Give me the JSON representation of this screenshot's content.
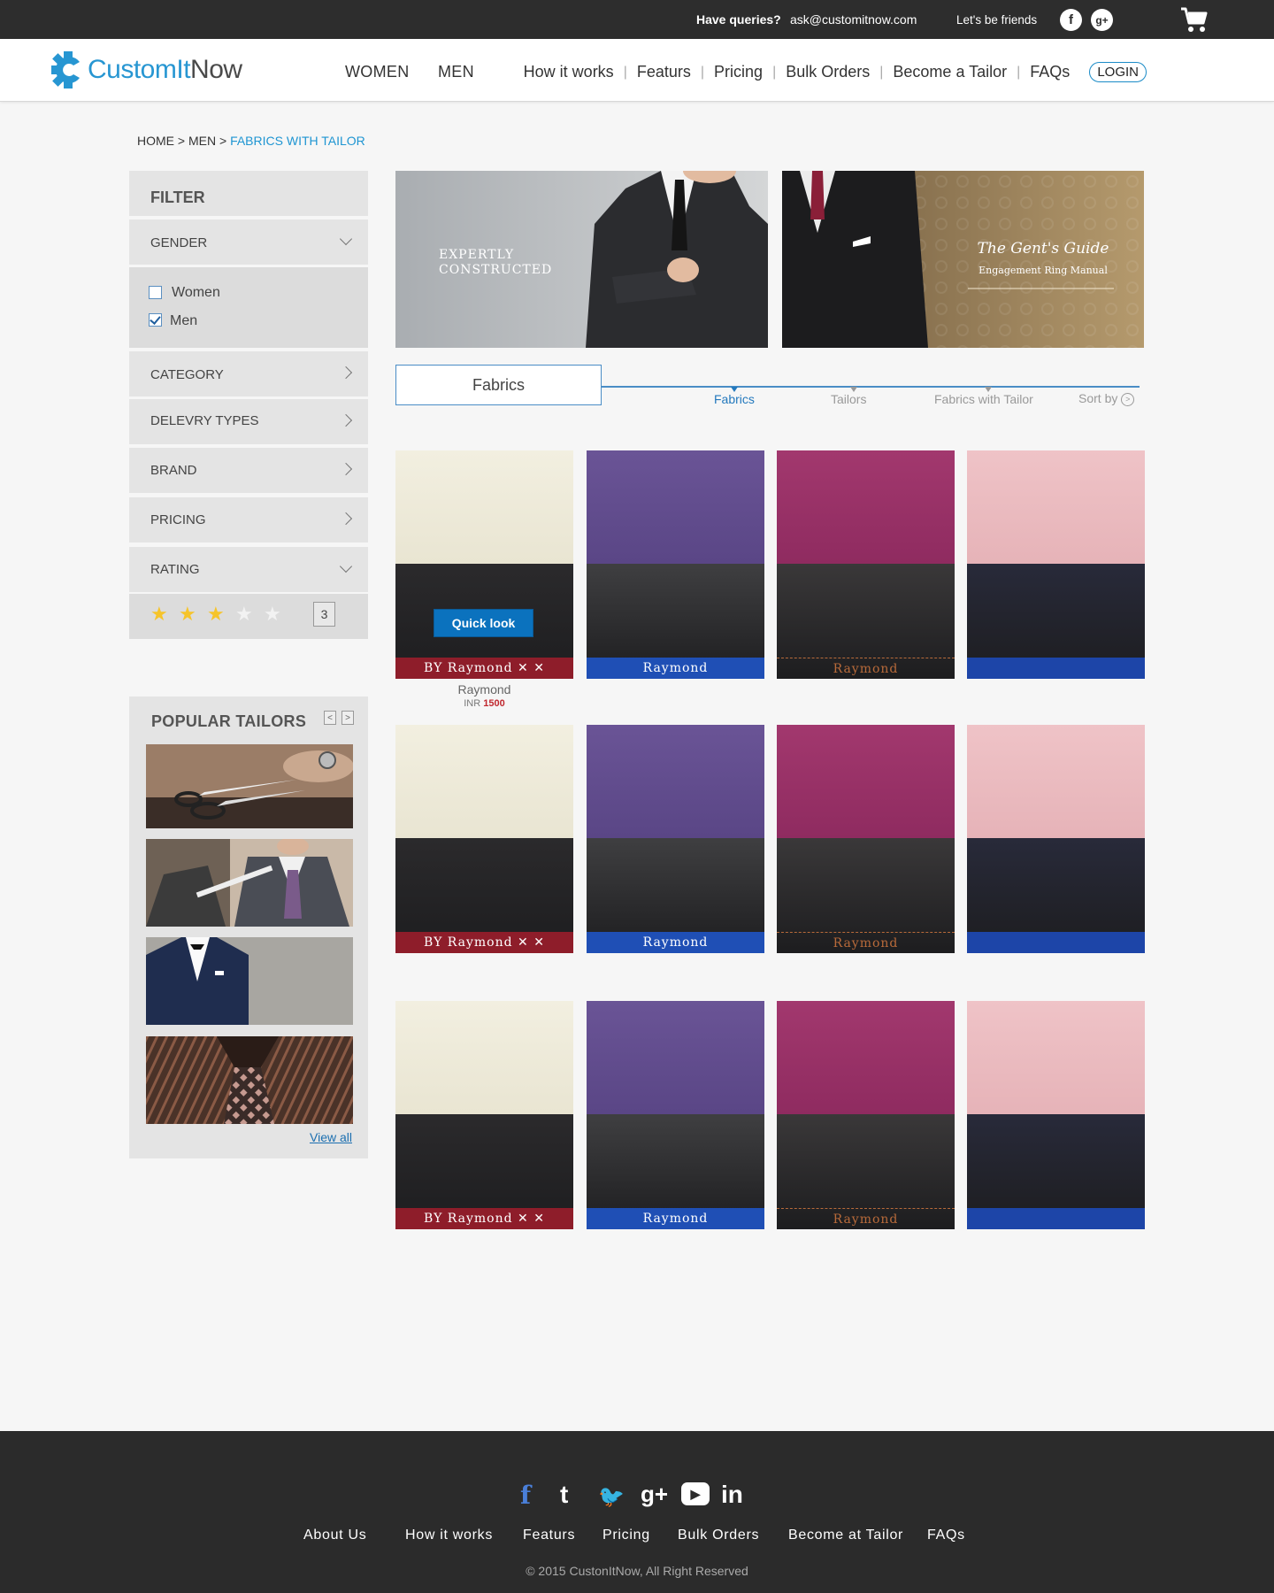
{
  "topbar": {
    "queries_label": "Have queries?",
    "email": "ask@customitnow.com",
    "friends_label": "Let's be friends",
    "facebook": "f",
    "gplus": "g+"
  },
  "header": {
    "logo_part1": "CustomIt",
    "logo_part2": "Now",
    "nav_women": "WOMEN",
    "nav_men": "MEN",
    "links": [
      "How it works",
      "Featurs",
      "Pricing",
      "Bulk Orders",
      "Become a Tailor",
      "FAQs"
    ],
    "login": "LOGIN"
  },
  "breadcrumb": {
    "home": "HOME",
    "men": "MEN",
    "current": "FABRICS WITH TAILOR",
    "sep": ">"
  },
  "filter": {
    "title": "FILTER",
    "gender": "GENDER",
    "women": "Women",
    "men": "Men",
    "women_checked": false,
    "men_checked": true,
    "category": "CATEGORY",
    "delivery": "DELEVRY TYPES",
    "brand": "BRAND",
    "pricing": "PRICING",
    "rating": "RATING",
    "rating_value": "3",
    "star_filled_color": "#f6c42a",
    "star_empty_color": "#f2f2f2"
  },
  "tailors": {
    "title": "POPULAR TAILORS",
    "view_all": "View all"
  },
  "banners": {
    "left_line1": "EXPERTLY",
    "left_line2": "CONSTRUCTED",
    "right_line1": "The Gent's Guide",
    "right_line2": "Engagement Ring Manual"
  },
  "tabs": {
    "box_label": "Fabrics",
    "fabrics": "Fabrics",
    "tailors": "Tailors",
    "fabrics_with_tailor": "Fabrics with Tailor",
    "sort_by": "Sort by",
    "active_color": "#2479bd"
  },
  "product": {
    "quick_look": "Quick look",
    "brand": "Raymond",
    "currency": "INR",
    "price": "1500",
    "selvedge_texts": [
      "BY  Raymond  ✕ ✕",
      "Raymond",
      "Raymond",
      ""
    ]
  },
  "colors": {
    "accent": "#1e95d2",
    "topbar": "#2d2d2d",
    "footer": "#2b2b2b",
    "sidebar": "#e4e4e4"
  },
  "footer": {
    "links": [
      "About Us",
      "How it works",
      "Featurs",
      "Pricing",
      "Bulk Orders",
      "Become at Tailor",
      "FAQs"
    ],
    "copyright": "© 2015 CustonItNow, All Right Reserved",
    "social": [
      "f",
      "t",
      "🐦",
      "g+",
      "▶",
      "in"
    ]
  }
}
